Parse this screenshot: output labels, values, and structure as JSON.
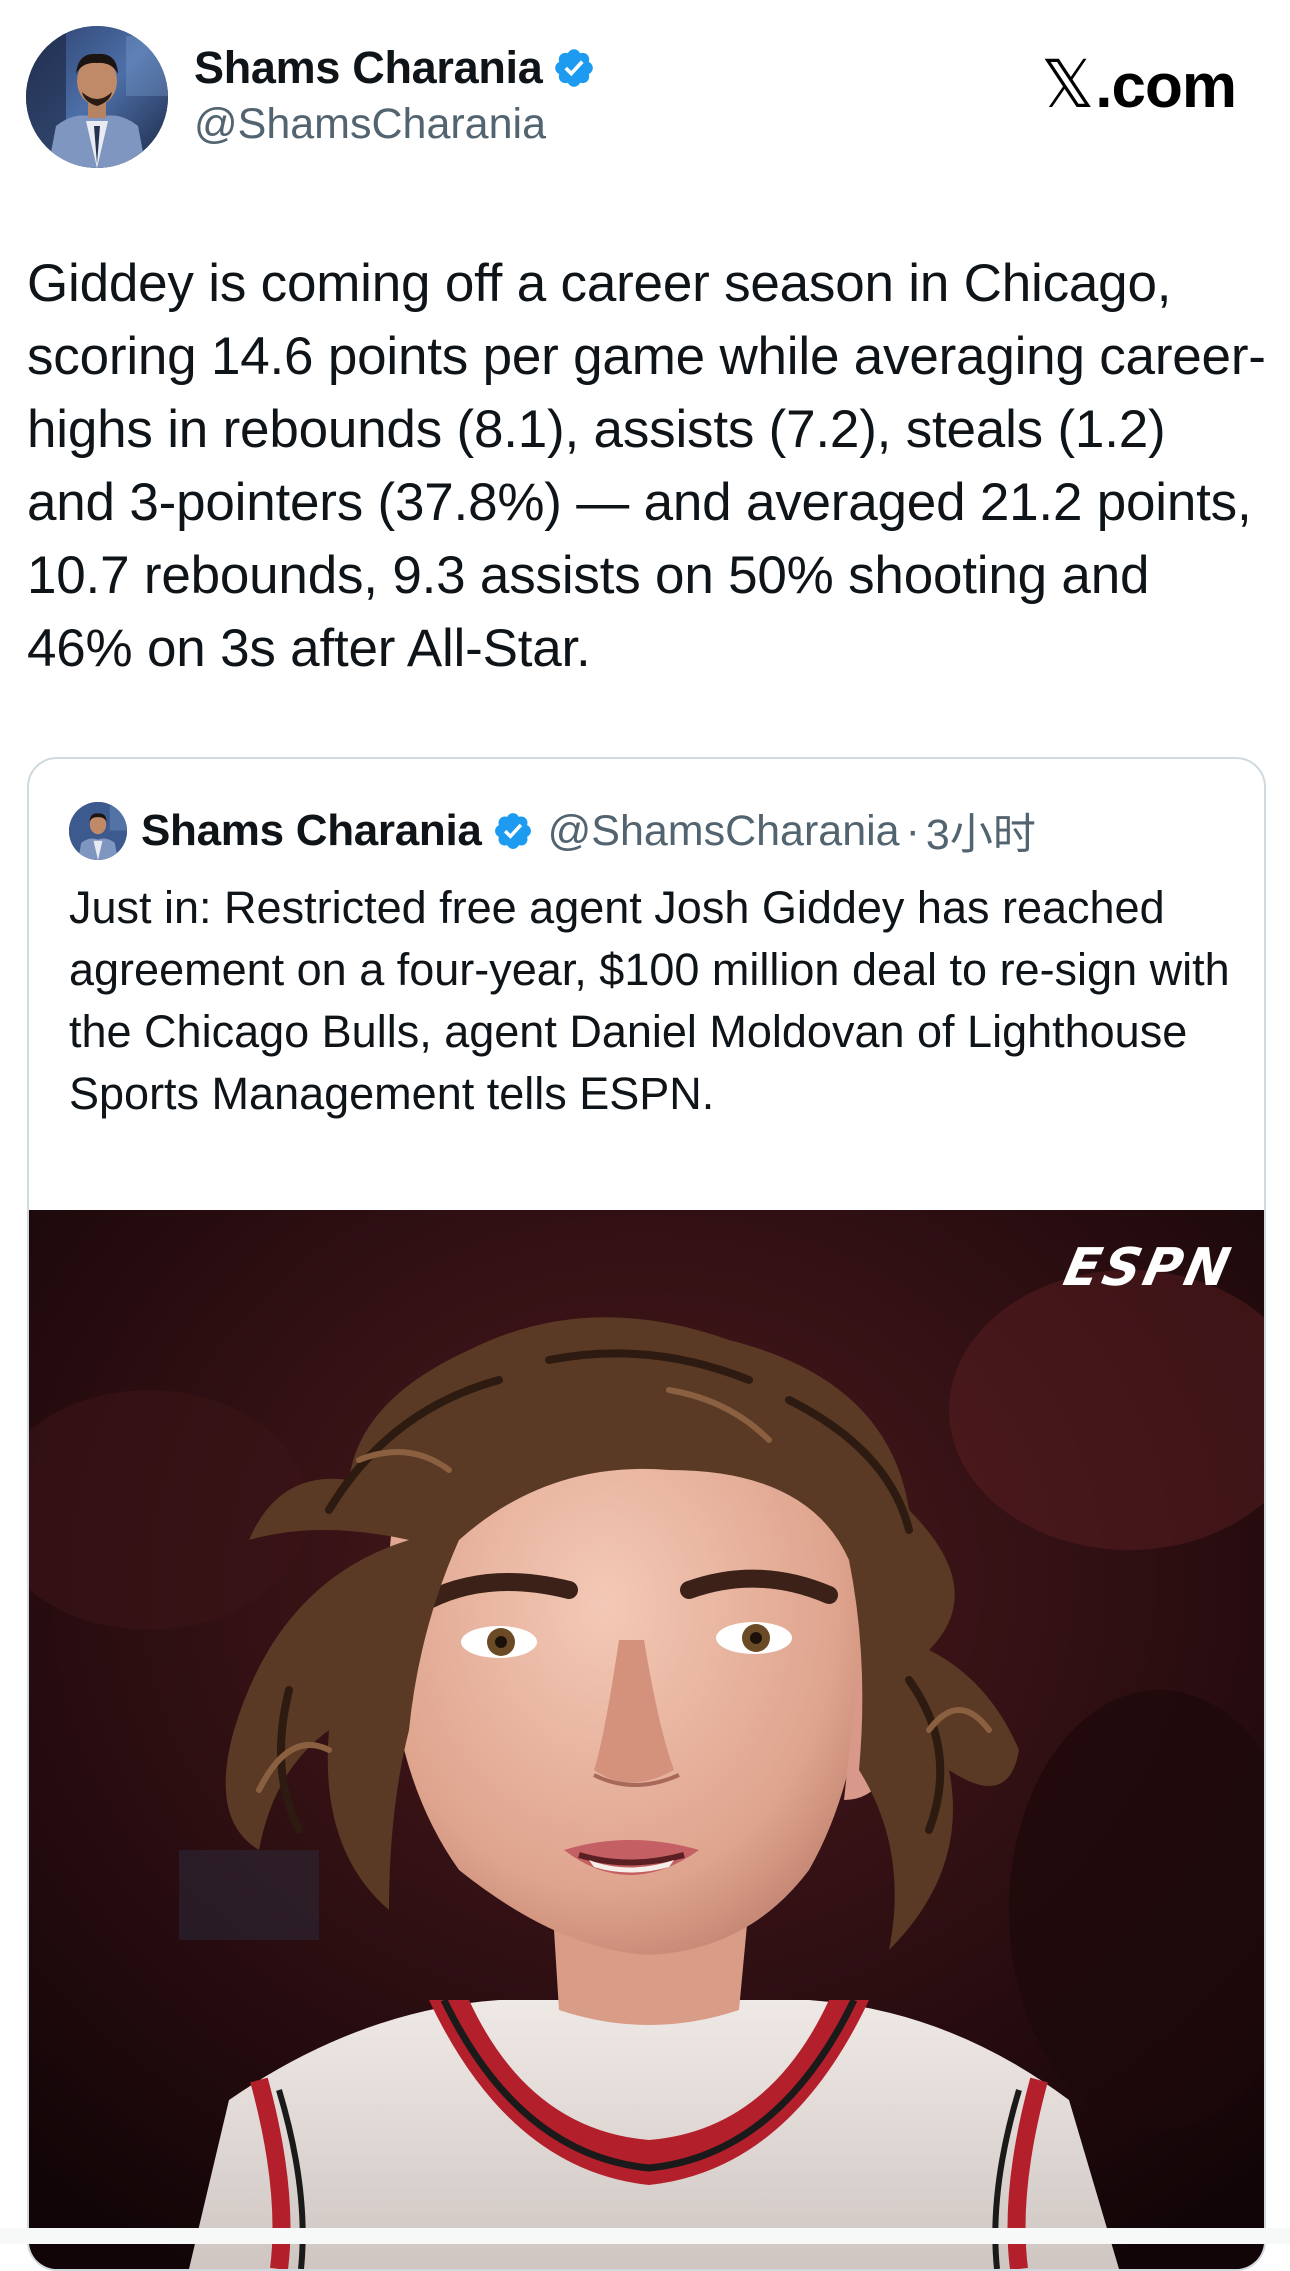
{
  "post": {
    "author": {
      "name": "Shams Charania",
      "handle": "@ShamsCharania",
      "avatar_icon": "profile-photo",
      "verified_icon": "verified-badge-icon"
    },
    "site_logo": {
      "mark": "𝕏",
      "suffix": ".com"
    },
    "text": "Giddey is coming off a career season in Chicago, scoring 14.6 points per game while averaging career-highs in rebounds (8.1), assists (7.2), steals (1.2) and 3-pointers (37.8%) — and averaged 21.2 points, 10.7 rebounds, 9.3 assists on 50% shooting and 46% on 3s after All-Star."
  },
  "quoted_post": {
    "author": {
      "name": "Shams Charania",
      "handle": "@ShamsCharania",
      "separator": "·",
      "time": "3小时"
    },
    "text": "Just in: Restricted free agent Josh Giddey has reached agreement on a four-year, $100 million deal to re-sign with the Chicago Bulls, agent Daniel Moldovan of Lighthouse Sports Management tells ESPN.",
    "media": {
      "watermark": "ESPN",
      "description_icon": "player-photo"
    }
  },
  "colors": {
    "text_primary": "#0f1419",
    "text_secondary": "#536471",
    "verified_blue": "#1d9bf0",
    "card_border": "#cfd9de"
  }
}
